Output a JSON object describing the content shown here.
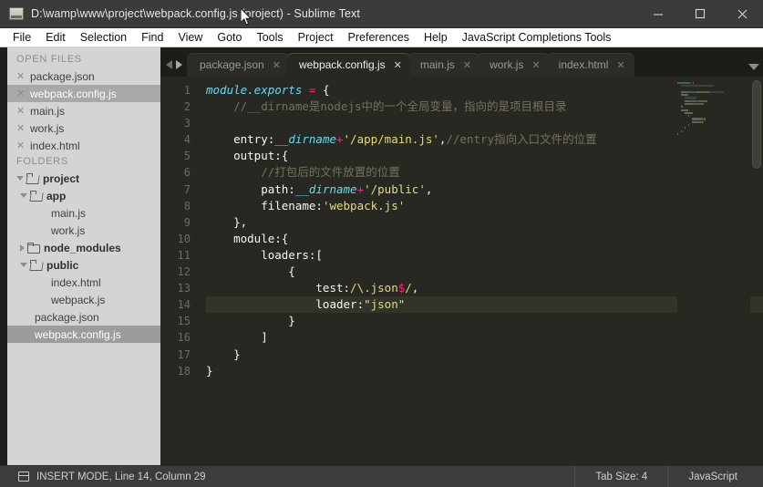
{
  "window": {
    "title": "D:\\wamp\\www\\project\\webpack.config.js (project) - Sublime Text",
    "minimize_label": "—",
    "maximize_label": "□",
    "close_label": "✕"
  },
  "menu": {
    "items": [
      "File",
      "Edit",
      "Selection",
      "Find",
      "View",
      "Goto",
      "Tools",
      "Project",
      "Preferences",
      "Help",
      "JavaScript Completions Tools"
    ]
  },
  "sidebar": {
    "open_files_header": "OPEN FILES",
    "open_files": [
      {
        "name": "package.json",
        "selected": false
      },
      {
        "name": "webpack.config.js",
        "selected": true
      },
      {
        "name": "main.js",
        "selected": false
      },
      {
        "name": "work.js",
        "selected": false
      },
      {
        "name": "index.html",
        "selected": false
      }
    ],
    "folders_header": "FOLDERS",
    "tree": [
      {
        "label": "project",
        "type": "folder",
        "indent": 0,
        "expanded": true,
        "selected": false
      },
      {
        "label": "app",
        "type": "folder",
        "indent": 1,
        "expanded": true,
        "selected": false
      },
      {
        "label": "main.js",
        "type": "file",
        "indent": 2,
        "selected": false
      },
      {
        "label": "work.js",
        "type": "file",
        "indent": 2,
        "selected": false
      },
      {
        "label": "node_modules",
        "type": "folder",
        "indent": 1,
        "expanded": false,
        "selected": false
      },
      {
        "label": "public",
        "type": "folder",
        "indent": 1,
        "expanded": true,
        "selected": false
      },
      {
        "label": "index.html",
        "type": "file",
        "indent": 2,
        "selected": false
      },
      {
        "label": "webpack.js",
        "type": "file",
        "indent": 2,
        "selected": false
      },
      {
        "label": "package.json",
        "type": "file",
        "indent": 1,
        "selected": false
      },
      {
        "label": "webpack.config.js",
        "type": "file",
        "indent": 1,
        "selected": true
      }
    ]
  },
  "tabs": {
    "prev_label": "◀",
    "next_label": "▶",
    "close_glyph": "✕",
    "items": [
      {
        "label": "package.json",
        "active": false,
        "closable": true
      },
      {
        "label": "webpack.config.js",
        "active": true,
        "closable": true
      },
      {
        "label": "main.js",
        "active": false,
        "closable": true
      },
      {
        "label": "work.js",
        "active": false,
        "closable": true
      },
      {
        "label": "index.html",
        "active": false,
        "closable": true
      }
    ]
  },
  "editor": {
    "line_numbers": [
      1,
      2,
      3,
      4,
      5,
      6,
      7,
      8,
      9,
      10,
      11,
      12,
      13,
      14,
      15,
      16,
      17,
      18
    ],
    "active_line": 14,
    "lines": [
      {
        "n": 1,
        "tokens": [
          {
            "t": "module.exports",
            "c": "kw-blue"
          },
          {
            "t": " ",
            "c": "kw-plain"
          },
          {
            "t": "=",
            "c": "op"
          },
          {
            "t": " {",
            "c": "kw-plain"
          }
        ]
      },
      {
        "n": 2,
        "tokens": [
          {
            "t": "    //__dirname是nodejs中的一个全局变量，指向的是项目根目录",
            "c": "com"
          }
        ]
      },
      {
        "n": 3,
        "tokens": [
          {
            "t": "",
            "c": "kw-plain"
          }
        ]
      },
      {
        "n": 4,
        "tokens": [
          {
            "t": "    entry:",
            "c": "kw-plain"
          },
          {
            "t": "__dirname",
            "c": "kw-blue"
          },
          {
            "t": "+",
            "c": "op"
          },
          {
            "t": "'/app/main.js'",
            "c": "str"
          },
          {
            "t": ",",
            "c": "kw-plain"
          },
          {
            "t": "//entry指向入口文件的位置",
            "c": "com"
          }
        ]
      },
      {
        "n": 5,
        "tokens": [
          {
            "t": "    output:{",
            "c": "kw-plain"
          }
        ]
      },
      {
        "n": 6,
        "tokens": [
          {
            "t": "        //打包后的文件放置的位置",
            "c": "com"
          }
        ]
      },
      {
        "n": 7,
        "tokens": [
          {
            "t": "        path:",
            "c": "kw-plain"
          },
          {
            "t": "__dirname",
            "c": "kw-blue"
          },
          {
            "t": "+",
            "c": "op"
          },
          {
            "t": "'/public'",
            "c": "str"
          },
          {
            "t": ",",
            "c": "kw-plain"
          }
        ]
      },
      {
        "n": 8,
        "tokens": [
          {
            "t": "        filename:",
            "c": "kw-plain"
          },
          {
            "t": "'webpack.js'",
            "c": "str"
          }
        ]
      },
      {
        "n": 9,
        "tokens": [
          {
            "t": "    },",
            "c": "kw-plain"
          }
        ]
      },
      {
        "n": 10,
        "tokens": [
          {
            "t": "    module:{",
            "c": "kw-plain"
          }
        ]
      },
      {
        "n": 11,
        "tokens": [
          {
            "t": "        loaders:[",
            "c": "kw-plain"
          }
        ]
      },
      {
        "n": 12,
        "tokens": [
          {
            "t": "            {",
            "c": "kw-plain"
          }
        ]
      },
      {
        "n": 13,
        "tokens": [
          {
            "t": "                test:",
            "c": "kw-plain"
          },
          {
            "t": "/\\.json",
            "c": "regex"
          },
          {
            "t": "$",
            "c": "op"
          },
          {
            "t": "/",
            "c": "regex"
          },
          {
            "t": ",",
            "c": "kw-plain"
          }
        ]
      },
      {
        "n": 14,
        "tokens": [
          {
            "t": "                loader:",
            "c": "kw-plain"
          },
          {
            "t": "\"json\"",
            "c": "str"
          }
        ]
      },
      {
        "n": 15,
        "tokens": [
          {
            "t": "            }",
            "c": "kw-plain"
          }
        ]
      },
      {
        "n": 16,
        "tokens": [
          {
            "t": "        ]",
            "c": "kw-plain"
          }
        ]
      },
      {
        "n": 17,
        "tokens": [
          {
            "t": "    }",
            "c": "kw-plain"
          }
        ]
      },
      {
        "n": 18,
        "tokens": [
          {
            "t": "}",
            "c": "kw-plain"
          }
        ]
      }
    ]
  },
  "statusbar": {
    "left": "INSERT MODE, Line 14, Column 29",
    "tab_size": "Tab Size: 4",
    "syntax": "JavaScript"
  },
  "colors": {
    "editor_bg": "#272822",
    "sidebar_bg": "#d4d4d4",
    "titlebar_bg": "#3b3b3b",
    "menubar_bg": "#ffffff",
    "statusbar_bg": "#3c3c3c",
    "accent_pink": "#f92672",
    "string_yellow": "#e6db74",
    "comment_gray": "#75715e",
    "keyword_cyan": "#66d9ef",
    "selection_gray": "#9c9c9c"
  }
}
